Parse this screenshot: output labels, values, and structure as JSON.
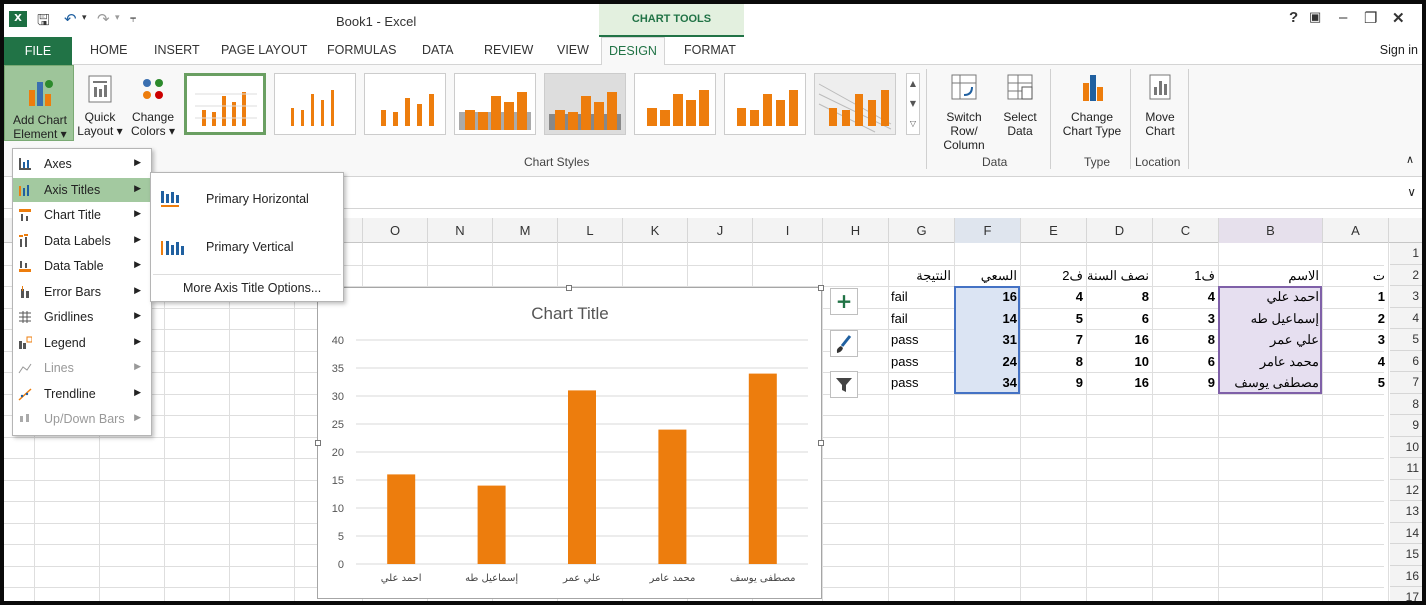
{
  "app": {
    "title": "Book1 - Excel",
    "context_tab_group": "CHART TOOLS",
    "help": "?",
    "sign_in": "Sign in"
  },
  "tabs": [
    "FILE",
    "HOME",
    "INSERT",
    "PAGE LAYOUT",
    "FORMULAS",
    "DATA",
    "REVIEW",
    "VIEW",
    "DESIGN",
    "FORMAT"
  ],
  "ribbon": {
    "add_chart_element": [
      "Add Chart",
      "Element"
    ],
    "quick_layout": [
      "Quick",
      "Layout"
    ],
    "change_colors": [
      "Change",
      "Colors"
    ],
    "chart_styles_label": "Chart Styles",
    "switch_row_column": [
      "Switch Row/",
      "Column"
    ],
    "select_data": [
      "Select",
      "Data"
    ],
    "data_group_label": "Data",
    "change_chart_type": [
      "Change",
      "Chart Type"
    ],
    "type_group_label": "Type",
    "move_chart": [
      "Move",
      "Chart"
    ],
    "location_group_label": "Location"
  },
  "menu": {
    "items": [
      {
        "label": "Axes",
        "icon": "axes-icon",
        "enabled": true
      },
      {
        "label": "Axis Titles",
        "icon": "axis-titles-icon",
        "enabled": true
      },
      {
        "label": "Chart Title",
        "icon": "chart-title-icon",
        "enabled": true
      },
      {
        "label": "Data Labels",
        "icon": "data-labels-icon",
        "enabled": true
      },
      {
        "label": "Data Table",
        "icon": "data-table-icon",
        "enabled": true
      },
      {
        "label": "Error Bars",
        "icon": "error-bars-icon",
        "enabled": true
      },
      {
        "label": "Gridlines",
        "icon": "gridlines-icon",
        "enabled": true
      },
      {
        "label": "Legend",
        "icon": "legend-icon",
        "enabled": true
      },
      {
        "label": "Lines",
        "icon": "lines-icon",
        "enabled": false
      },
      {
        "label": "Trendline",
        "icon": "trendline-icon",
        "enabled": true
      },
      {
        "label": "Up/Down Bars",
        "icon": "up-down-bars-icon",
        "enabled": false
      }
    ],
    "active": "Axis Titles"
  },
  "submenu": {
    "primary_horizontal": "Primary Horizontal",
    "primary_vertical": "Primary Vertical",
    "more_options": "More Axis Title Options..."
  },
  "columns": [
    "O",
    "N",
    "M",
    "L",
    "K",
    "J",
    "I",
    "H",
    "G",
    "F",
    "E",
    "D",
    "C",
    "B",
    "A"
  ],
  "rows": [
    "1",
    "2",
    "3",
    "4",
    "5",
    "6",
    "7",
    "8",
    "9",
    "10",
    "11",
    "12",
    "13",
    "14",
    "15",
    "16",
    "17"
  ],
  "sheet": {
    "headers": {
      "G": "النتيجة",
      "F": "السعي",
      "E": "ف2",
      "D": "نصف السنة",
      "C": "ف1",
      "B": "الاسم",
      "A": "ت"
    },
    "records": [
      {
        "A": "1",
        "B": "احمد علي",
        "C": "4",
        "D": "8",
        "E": "4",
        "F": "16",
        "G": "fail"
      },
      {
        "A": "2",
        "B": "إسماعيل طه",
        "C": "3",
        "D": "6",
        "E": "5",
        "F": "14",
        "G": "fail"
      },
      {
        "A": "3",
        "B": "علي عمر",
        "C": "8",
        "D": "16",
        "E": "7",
        "F": "31",
        "G": "pass"
      },
      {
        "A": "4",
        "B": "محمد عامر",
        "C": "6",
        "D": "10",
        "E": "8",
        "F": "24",
        "G": "pass"
      },
      {
        "A": "5",
        "B": "مصطفى يوسف",
        "C": "9",
        "D": "16",
        "E": "9",
        "F": "34",
        "G": "pass"
      }
    ]
  },
  "chart_data": {
    "type": "bar",
    "title": "Chart Title",
    "categories": [
      "احمد علي",
      "إسماعيل طه",
      "علي عمر",
      "محمد عامر",
      "مصطفى يوسف"
    ],
    "values": [
      16,
      14,
      31,
      24,
      34
    ],
    "ylim": [
      0,
      40
    ],
    "yticks": [
      "0",
      "5",
      "10",
      "15",
      "20",
      "25",
      "30",
      "35",
      "40"
    ],
    "grid": true,
    "bar_color": "#ed7d0d"
  },
  "colors": {
    "accent": "#217346",
    "bar": "#ed7d0d"
  }
}
